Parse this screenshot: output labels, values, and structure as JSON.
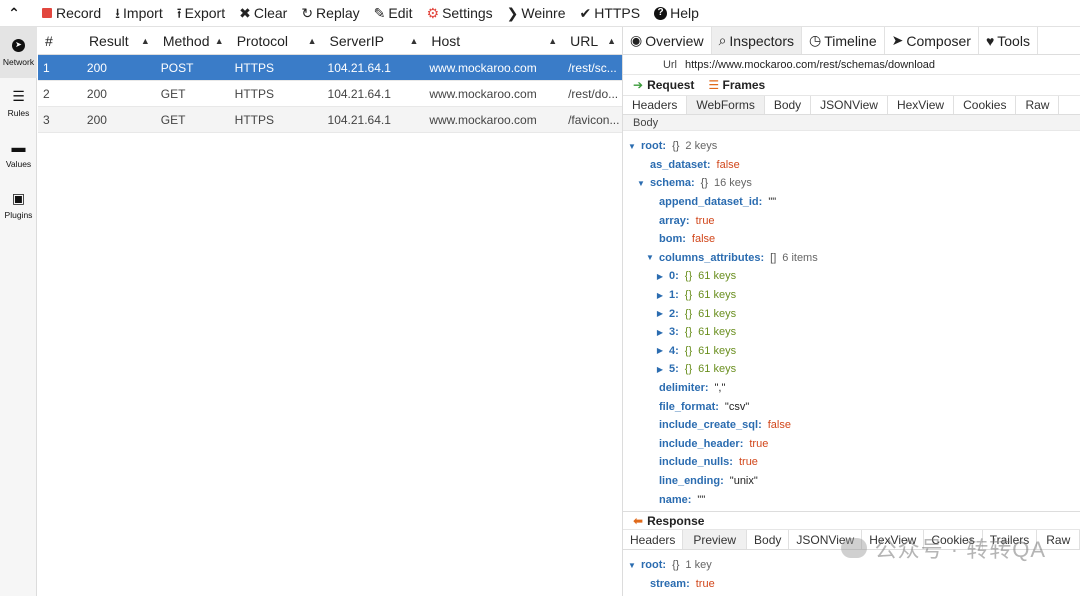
{
  "toolbar": {
    "items": [
      {
        "icon": "record-icon",
        "label": "Record"
      },
      {
        "icon": "import-icon",
        "label": "Import"
      },
      {
        "icon": "export-icon",
        "label": "Export"
      },
      {
        "icon": "clear-icon",
        "label": "Clear"
      },
      {
        "icon": "replay-icon",
        "label": "Replay"
      },
      {
        "icon": "edit-icon",
        "label": "Edit"
      },
      {
        "icon": "settings-icon",
        "label": "Settings"
      },
      {
        "icon": "weinre-icon",
        "label": "Weinre"
      },
      {
        "icon": "check-icon",
        "label": "HTTPS"
      },
      {
        "icon": "help-icon",
        "label": "Help"
      }
    ]
  },
  "sidebar": {
    "items": [
      {
        "icon": "network-icon",
        "label": "Network"
      },
      {
        "icon": "rules-icon",
        "label": "Rules"
      },
      {
        "icon": "values-icon",
        "label": "Values"
      },
      {
        "icon": "plugins-icon",
        "label": "Plugins"
      }
    ]
  },
  "table": {
    "headers": [
      "#",
      "Result",
      "Method",
      "Protocol",
      "ServerIP",
      "Host",
      "URL"
    ],
    "rows": [
      [
        "1",
        "200",
        "POST",
        "HTTPS",
        "104.21.64.1",
        "www.mockaroo.com",
        "/rest/sc..."
      ],
      [
        "2",
        "200",
        "GET",
        "HTTPS",
        "104.21.64.1",
        "www.mockaroo.com",
        "/rest/do..."
      ],
      [
        "3",
        "200",
        "GET",
        "HTTPS",
        "104.21.64.1",
        "www.mockaroo.com",
        "/favicon..."
      ]
    ]
  },
  "inspector": {
    "tabs": [
      "Overview",
      "Inspectors",
      "Timeline",
      "Composer",
      "Tools"
    ],
    "url_label": "Url",
    "url_value": "https://www.mockaroo.com/rest/schemas/download",
    "request_label": "Request",
    "frames_label": "Frames",
    "request_tabs": [
      "Headers",
      "WebForms",
      "Body",
      "JSONView",
      "HexView",
      "Cookies",
      "Raw"
    ],
    "body_label": "Body",
    "response_label": "Response",
    "response_tabs": [
      "Headers",
      "Preview",
      "Body",
      "JSONView",
      "HexView",
      "Cookies",
      "Trailers",
      "Raw"
    ],
    "colors": {
      "selected_row": "#3a7cc8",
      "key": "#2b6cb0",
      "bool": "#d1461a"
    }
  },
  "request_tree": {
    "root": {
      "key": "root",
      "brace": "{}",
      "meta": "2 keys"
    },
    "as_dataset": {
      "key": "as_dataset",
      "value": "false"
    },
    "schema": {
      "key": "schema",
      "brace": "{}",
      "meta": "16 keys"
    },
    "append_dataset_id": {
      "key": "append_dataset_id",
      "value": "\"\""
    },
    "array": {
      "key": "array",
      "value": "true"
    },
    "bom": {
      "key": "bom",
      "value": "false"
    },
    "columns_attributes": {
      "key": "columns_attributes",
      "brace": "[]",
      "meta": "6 items"
    },
    "items": [
      {
        "key": "0",
        "brace": "{}",
        "meta": "61 keys"
      },
      {
        "key": "1",
        "brace": "{}",
        "meta": "61 keys"
      },
      {
        "key": "2",
        "brace": "{}",
        "meta": "61 keys"
      },
      {
        "key": "3",
        "brace": "{}",
        "meta": "61 keys"
      },
      {
        "key": "4",
        "brace": "{}",
        "meta": "61 keys"
      },
      {
        "key": "5",
        "brace": "{}",
        "meta": "61 keys"
      }
    ],
    "delimiter": {
      "key": "delimiter",
      "value": "\",\""
    },
    "file_format": {
      "key": "file_format",
      "value": "\"csv\""
    },
    "include_create_sql": {
      "key": "include_create_sql",
      "value": "false"
    },
    "include_header": {
      "key": "include_header",
      "value": "true"
    },
    "include_nulls": {
      "key": "include_nulls",
      "value": "true"
    },
    "line_ending": {
      "key": "line_ending",
      "value": "\"unix\""
    },
    "name": {
      "key": "name",
      "value": "\"\""
    }
  },
  "response_tree": {
    "root": {
      "key": "root",
      "brace": "{}",
      "meta": "1 key"
    },
    "stream": {
      "key": "stream",
      "value": "true"
    }
  },
  "watermark": "公众号 · 转转QA"
}
